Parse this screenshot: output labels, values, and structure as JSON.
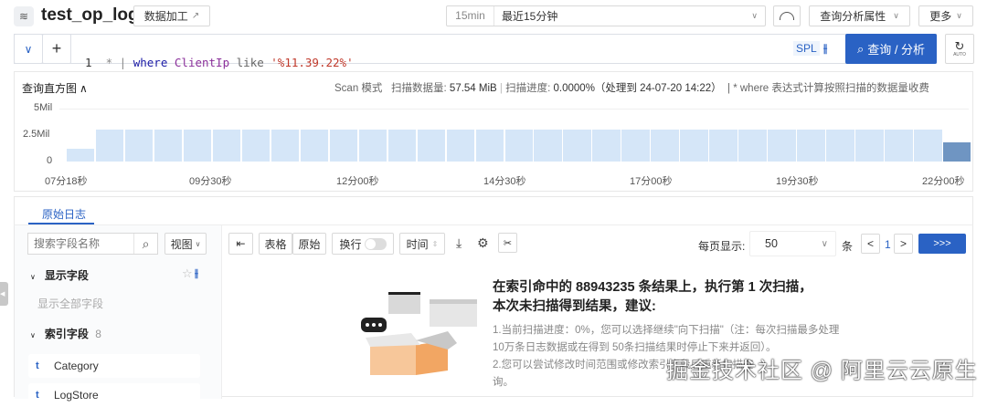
{
  "header": {
    "title": "test_op_log",
    "data_process_label": "数据加工",
    "time_short": "15min",
    "time_range": "最近15分钟",
    "query_props_label": "查询分析属性",
    "more_label": "更多"
  },
  "query": {
    "line_no": "1",
    "star": "*",
    "pipe": "|",
    "kw_where": "where",
    "field": "ClientIp",
    "kw_like": "like",
    "value": "'%11.39.22%'",
    "spl_label": "SPL",
    "search_label": "查询 / 分析",
    "auto_label": "AUTO"
  },
  "histogram": {
    "title": "查询直方图",
    "scan_mode": "Scan 模式",
    "scan_size_label": "扫描数据量:",
    "scan_size": "57.54 MiB",
    "sep": "|",
    "scan_progress_label": "扫描进度:",
    "scan_progress": "0.0000%（处理到 24-07-20 14:22）",
    "note": "| * where 表达式计算按照扫描的数据量收费"
  },
  "chart_data": {
    "type": "bar",
    "ylabel": "",
    "xlabel": "",
    "ylim": [
      0,
      5
    ],
    "y_ticks": [
      "5Mil",
      "2.5Mil",
      "0"
    ],
    "x_ticks": [
      "07分18秒",
      "09分30秒",
      "12分00秒",
      "14分30秒",
      "17分00秒",
      "19分30秒",
      "22分00秒"
    ],
    "values": [
      1.2,
      3.0,
      3.05,
      3.0,
      3.05,
      3.0,
      3.0,
      3.0,
      3.05,
      3.0,
      3.05,
      3.05,
      3.05,
      3.0,
      3.05,
      3.0,
      3.05,
      3.05,
      3.05,
      3.05,
      3.05,
      3.0,
      3.05,
      3.0,
      3.05,
      3.0,
      3.05,
      3.0,
      3.05,
      3.0,
      1.8
    ],
    "unit": "Mil",
    "highlight_last": true,
    "colors": {
      "bar": "#d5e6f8",
      "last": "#6f95c2"
    }
  },
  "logs": {
    "tab_label": "原始日志",
    "search_placeholder": "搜索字段名称",
    "view_label": "视图",
    "display_fields_label": "显示字段",
    "show_all_label": "显示全部字段",
    "index_fields_label": "索引字段",
    "index_count": "8",
    "fields": [
      {
        "type": "t",
        "name": "Category"
      },
      {
        "type": "t",
        "name": "LogStore"
      }
    ],
    "toolbar": {
      "table_label": "表格",
      "raw_label": "原始",
      "wrap_label": "换行",
      "time_label": "时间",
      "page_size_label": "每页显示:",
      "page_size": "50",
      "unit": "条",
      "page": "1",
      "next_scan_label": ">>>"
    },
    "empty": {
      "title_line1": "在索引命中的 88943235 条结果上，执行第 1 次扫描，",
      "title_line2": "本次未扫描得到结果，建议:",
      "tip1a": "1.当前扫描进度：0%，您可以选择继续\"向下扫描\"（注：每次扫描最多处理",
      "tip1b": "10万条日志数据或在得到 50条扫描结果时停止下来并返回）。",
      "tip2a": "2.您可以尝试修改时间范围或修改索引字段后重新扫描查",
      "tip2b": "询。"
    }
  },
  "watermark": "掘金技术社区 @ 阿里云云原生",
  "colors": {
    "primary": "#2a62c4"
  }
}
